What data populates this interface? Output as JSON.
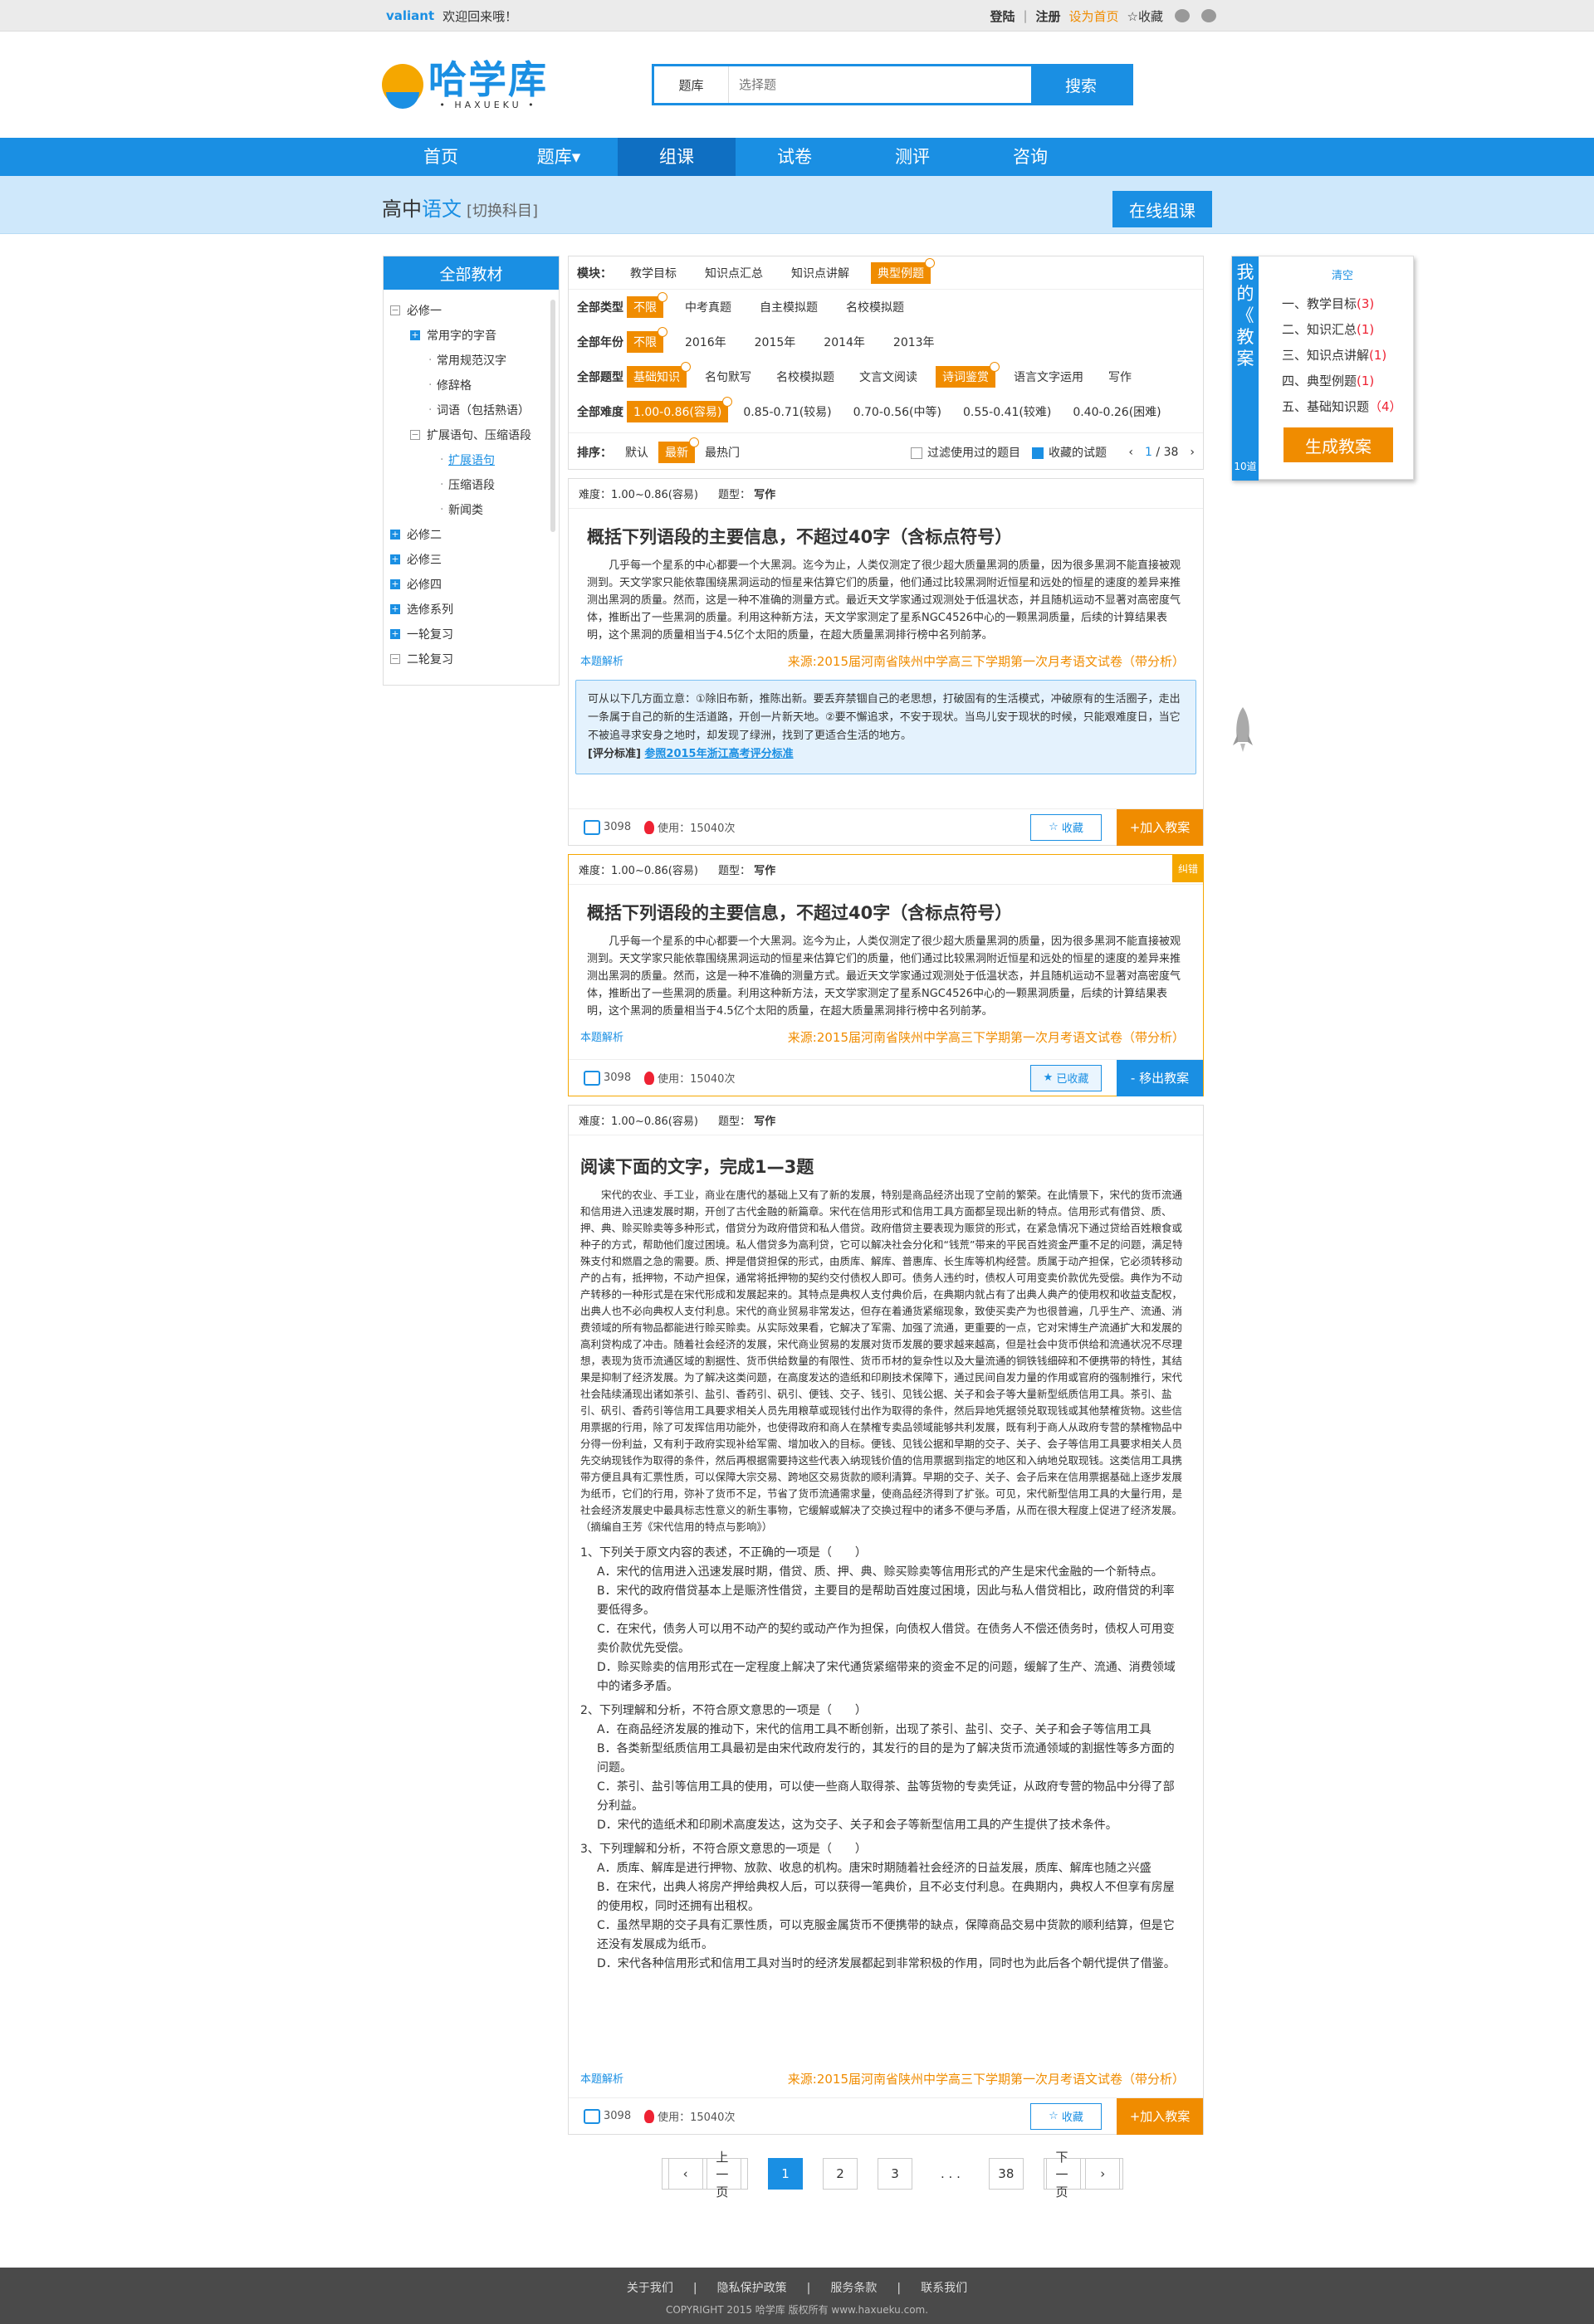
{
  "topbar": {
    "user": "valiant",
    "welcome": "欢迎回来哦！",
    "login": "登陆",
    "sep": "|",
    "register": "注册",
    "set_home": "设为首页",
    "favorite": "☆收藏"
  },
  "logo": {
    "name": "哈学库",
    "sub": "• HAXUEKU •"
  },
  "search": {
    "category": "题库",
    "placeholder": "选择题",
    "button": "搜索"
  },
  "nav": [
    "首页",
    "题库",
    "组课",
    "试卷",
    "测评",
    "咨询"
  ],
  "subject": {
    "level": "高中",
    "name": "语文",
    "switch": "[切换科目]",
    "online": "在线组课"
  },
  "sidebar": {
    "title": "全部教材",
    "items": [
      "必修一",
      "常用字的字音",
      "常用规范汉字",
      "修辞格",
      "词语（包括熟语）",
      "扩展语句、压缩语段",
      "扩展语句",
      "压缩语段",
      "新闻类",
      "必修二",
      "必修三",
      "必修四",
      "选修系列",
      "一轮复习",
      "二轮复习"
    ]
  },
  "filter": {
    "tabs_label": "模块：",
    "tabs": [
      "教学目标",
      "知识点汇总",
      "知识点讲解",
      "典型例题"
    ],
    "type_label": "全部类型",
    "types": [
      "不限",
      "中考真题",
      "自主模拟题",
      "名校模拟题"
    ],
    "year_label": "全部年份",
    "years": [
      "不限",
      "2016年",
      "2015年",
      "2014年",
      "2013年"
    ],
    "qtype_label": "全部题型",
    "qtypes": [
      "基础知识",
      "名句默写",
      "名校模拟题",
      "文言文阅读",
      "诗词鉴赏",
      "语言文字运用",
      "写作"
    ],
    "diff_label": "全部难度",
    "diffs": [
      "1.00-0.86(容易)",
      "0.85-0.71(较易)",
      "0.70-0.56(中等)",
      "0.55-0.41(较难)",
      "0.40-0.26(困难)"
    ],
    "sort_label": "排序：",
    "sorts": [
      "默认",
      "最新",
      "最热门"
    ],
    "filter_used": "过滤使用过的题目",
    "collected": "收藏的试题",
    "page": "1",
    "total": "/ 38"
  },
  "cards": [
    {
      "difficulty": "难度：1.00~0.86(容易)",
      "type_label": "题型：",
      "type": "写作",
      "title": "概括下列语段的主要信息，不超过40字（含标点符号）",
      "body": "几乎每一个星系的中心都要一个大黑洞。迄今为止，人类仅测定了很少超大质量黑洞的质量，因为很多黑洞不能直接被观测到。天文学家只能依靠围绕黑洞运动的恒星来估算它们的质量，他们通过比较黑洞附近恒星和远处的恒星的速度的差异来推测出黑洞的质量。然而，这是一种不准确的测量方式。最近天文学家通过观测处于低温状态，并且随机运动不显著对高密度气体，推断出了一些黑洞的质量。利用这种新方法，天文学家测定了星系NGC4526中心的一颗黑洞质量，后续的计算结果表明，这个黑洞的质量相当于4.5亿个太阳的质量，在超大质量黑洞排行榜中名列前茅。",
      "analysis_link": "本题解析",
      "source": "来源:2015届河南省陕州中学高三下学期第一次月考语文试卷（带分析）",
      "analysis": "可从以下几方面立意：①除旧布新，推陈出新。要丢弃禁锢自己的老思想，打破固有的生活模式，冲破原有的生活圈子，走出一条属于自己的新的生活道路，开创一片新天地。②要不懈追求，不安于现状。当鸟儿安于现状的时候，只能艰难度日，当它不被追寻求安身之地时，却发现了绿洲，找到了更适合生活的地方。",
      "std_label": "[评分标准]",
      "std_link": "参照2015年浙江高考评分标准",
      "likes": "3098",
      "used": "使用：15040次",
      "fav": "收藏",
      "action": "+加入教案"
    },
    {
      "difficulty": "难度：1.00~0.86(容易)",
      "type_label": "题型：",
      "type": "写作",
      "title": "概括下列语段的主要信息，不超过40字（含标点符号）",
      "body": "几乎每一个星系的中心都要一个大黑洞。迄今为止，人类仅测定了很少超大质量黑洞的质量，因为很多黑洞不能直接被观测到。天文学家只能依靠围绕黑洞运动的恒星来估算它们的质量，他们通过比较黑洞附近恒星和远处的恒星的速度的差异来推测出黑洞的质量。然而，这是一种不准确的测量方式。最近天文学家通过观测处于低温状态，并且随机运动不显著对高密度气体，推断出了一些黑洞的质量。利用这种新方法，天文学家测定了星系NGC4526中心的一颗黑洞质量，后续的计算结果表明，这个黑洞的质量相当于4.5亿个太阳的质量，在超大质量黑洞排行榜中名列前茅。",
      "analysis_link": "本题解析",
      "source": "来源:2015届河南省陕州中学高三下学期第一次月考语文试卷（带分析）",
      "corner": "纠错",
      "likes": "3098",
      "used": "使用：15040次",
      "fav": "已收藏",
      "action": "- 移出教案"
    },
    {
      "difficulty": "难度：1.00~0.86(容易)",
      "type_label": "题型：",
      "type": "写作",
      "title": "阅读下面的文字，完成1—3题",
      "body": "宋代的农业、手工业，商业在唐代的基础上又有了新的发展，特别是商品经济出现了空前的繁荣。在此情景下，宋代的货币流通和信用进入迅速发展时期，开创了古代金融的新篇章。宋代在信用形式和信用工具方面都呈现出新的特点。信用形式有借贷、质、押、典、赊买赊卖等多种形式，借贷分为政府借贷和私人借贷。政府借贷主要表现为赈贷的形式，在紧急情况下通过贷给百姓粮食或种子的方式，帮助他们度过困境。私人借贷多为高利贷，它可以解决社会分化和“钱荒”带来的平民百姓资金严重不足的问题，满足特殊支付和燃眉之急的需要。质、押是借贷担保的形式，由质库、解库、普惠库、长生库等机构经营。质属于动产担保，它必须转移动产的占有，抵押物，不动产担保，通常将抵押物的契约交付债权人即可。债务人违约时，债权人可用变卖价款优先受偿。典作为不动产转移的一种形式是在宋代形成和发展起来的。其特点是典权人支付典价后，在典期内就占有了出典人典产的使用权和收益支配权，出典人也不必向典权人支付利息。宋代的商业贸易非常发达，但存在着通货紧缩现象，致使买卖产为也很普遍，几乎生产、流通、消费领域的所有物品都能进行赊买赊卖。从实际效果看，它解决了军需、加强了流通，更重要的一点，它对宋博生产流通扩大和发展的高利贷构成了冲击。随着社会经济的发展，宋代商业贸易的发展对货币发展的要求越来越高，但是社会中货币供给和流通状况不尽理想，表现为货币流通区域的割据性、货币供给数量的有限性、货币币材的复杂性以及大量流通的铜铁钱细碎和不便携带的特性，其结果是抑制了经济发展。为了解决这类问题，在高度发达的造纸和印刷技术保障下，通过民间自发力量的作用或官府的强制推行，宋代社会陆续涌现出诸如茶引、盐引、香药引、矾引、便钱、交子、钱引、见钱公据、关子和会子等大量新型纸质信用工具。茶引、盐引、矾引、香药引等信用工具要求相关人员先用粮草或现钱付出作为取得的条件，然后异地凭据领兑取现钱或其他禁榷货物。这些信用票据的行用，除了可发挥信用功能外，也使得政府和商人在禁榷专卖品领域能够共利发展，既有利于商人从政府专营的禁榷物品中分得一份利益，又有利于政府实现补给军需、增加收入的目标。便钱、见钱公据和早期的交子、关子、会子等信用工具要求相关人员先交纳现钱作为取得的条件，然后再根据需要持这些代表入纳现钱价值的信用票据到指定的地区和入纳地兑取现钱。这类信用工具携带方便且具有汇票性质，可以保障大宗交易、跨地区交易货款的顺利清算。早期的交子、关子、会子后来在信用票据基础上逐步发展为纸币，它们的行用，弥补了货币不足，节省了货币流通需求量，使商品经济得到了扩张。可见，宋代新型信用工具的大量行用，是社会经济发展史中最具标志性意义的新生事物，它缓解或解决了交换过程中的诸多不便与矛盾，从而在很大程度上促进了经济发展。（摘编自王芳《宋代信用的特点与影响》）",
      "questions": [
        {
          "q": "1、下列关于原文内容的表述，不正确的一项是（　　）",
          "opts": [
            "A．宋代的信用进入迅速发展时期，借贷、质、押、典、赊买赊卖等信用形式的产生是宋代金融的一个新特点。",
            "B．宋代的政府借贷基本上是赈济性借贷，主要目的是帮助百姓度过困境，因此与私人借贷相比，政府借贷的利率要低得多。",
            "C．在宋代，债务人可以用不动产的契约或动产作为担保，向债权人借贷。在债务人不偿还债务时，债权人可用变卖价款优先受偿。",
            "D．赊买赊卖的信用形式在一定程度上解决了宋代通货紧缩带来的资金不足的问题，缓解了生产、流通、消费领域中的诸多矛盾。"
          ]
        },
        {
          "q": "2、下列理解和分析，不符合原文意思的一项是（　　）",
          "opts": [
            "A．在商品经济发展的推动下，宋代的信用工具不断创新，出现了茶引、盐引、交子、关子和会子等信用工具",
            "B．各类新型纸质信用工具最初是由宋代政府发行的，其发行的目的是为了解决货币流通领域的割据性等多方面的问题。",
            "C．茶引、盐引等信用工具的使用，可以使一些商人取得茶、盐等货物的专卖凭证，从政府专营的物品中分得了部分利益。",
            "D．宋代的造纸术和印刷术高度发达，这为交子、关子和会子等新型信用工具的产生提供了技术条件。"
          ]
        },
        {
          "q": "3、下列理解和分析，不符合原文意思的一项是（　　）",
          "opts": [
            "A．质库、解库是进行押物、放款、收息的机构。唐宋时期随着社会经济的日益发展，质库、解库也随之兴盛",
            "B．在宋代，出典人将房产押给典权人后，可以获得一笔典价，且不必支付利息。在典期内，典权人不但享有房屋的使用权，同时还拥有出租权。",
            "C．虽然早期的交子具有汇票性质，可以克服金属货币不便携带的缺点，保障商品交易中货款的顺利结算，但是它还没有发展成为纸币。",
            "D．宋代各种信用形式和信用工具对当时的经济发展都起到非常积极的作用，同时也为此后各个朝代提供了借鉴。"
          ]
        }
      ],
      "analysis_link": "本题解析",
      "source": "来源:2015届河南省陕州中学高三下学期第一次月考语文试卷（带分析）",
      "likes": "3098",
      "used": "使用：15040次",
      "fav": "收藏",
      "action": "+加入教案"
    }
  ],
  "pagination": {
    "prev": "上一页",
    "pages": [
      "1",
      "2",
      "3"
    ],
    "dots": ". . .",
    "last": "38",
    "next": "下一页"
  },
  "plan": {
    "title": [
      "我",
      "的",
      "《",
      "教",
      "案"
    ],
    "count": "10道",
    "clear": "清空",
    "items": [
      {
        "label": "一、教学目标",
        "n": "(3)"
      },
      {
        "label": "二、知识汇总",
        "n": "(1)"
      },
      {
        "label": "三、知识点讲解",
        "n": "(1)"
      },
      {
        "label": "四、典型例题",
        "n": "(1)"
      },
      {
        "label": "五、基础知识题",
        "n": "（4）"
      }
    ],
    "generate": "生成教案"
  },
  "footer": {
    "links": [
      "关于我们",
      "|",
      "隐私保护政策",
      "|",
      "服务条款",
      "|",
      "联系我们"
    ],
    "copyright": "COPYRIGHT 2015  哈学库  版权所有  www.haxueku.com."
  }
}
